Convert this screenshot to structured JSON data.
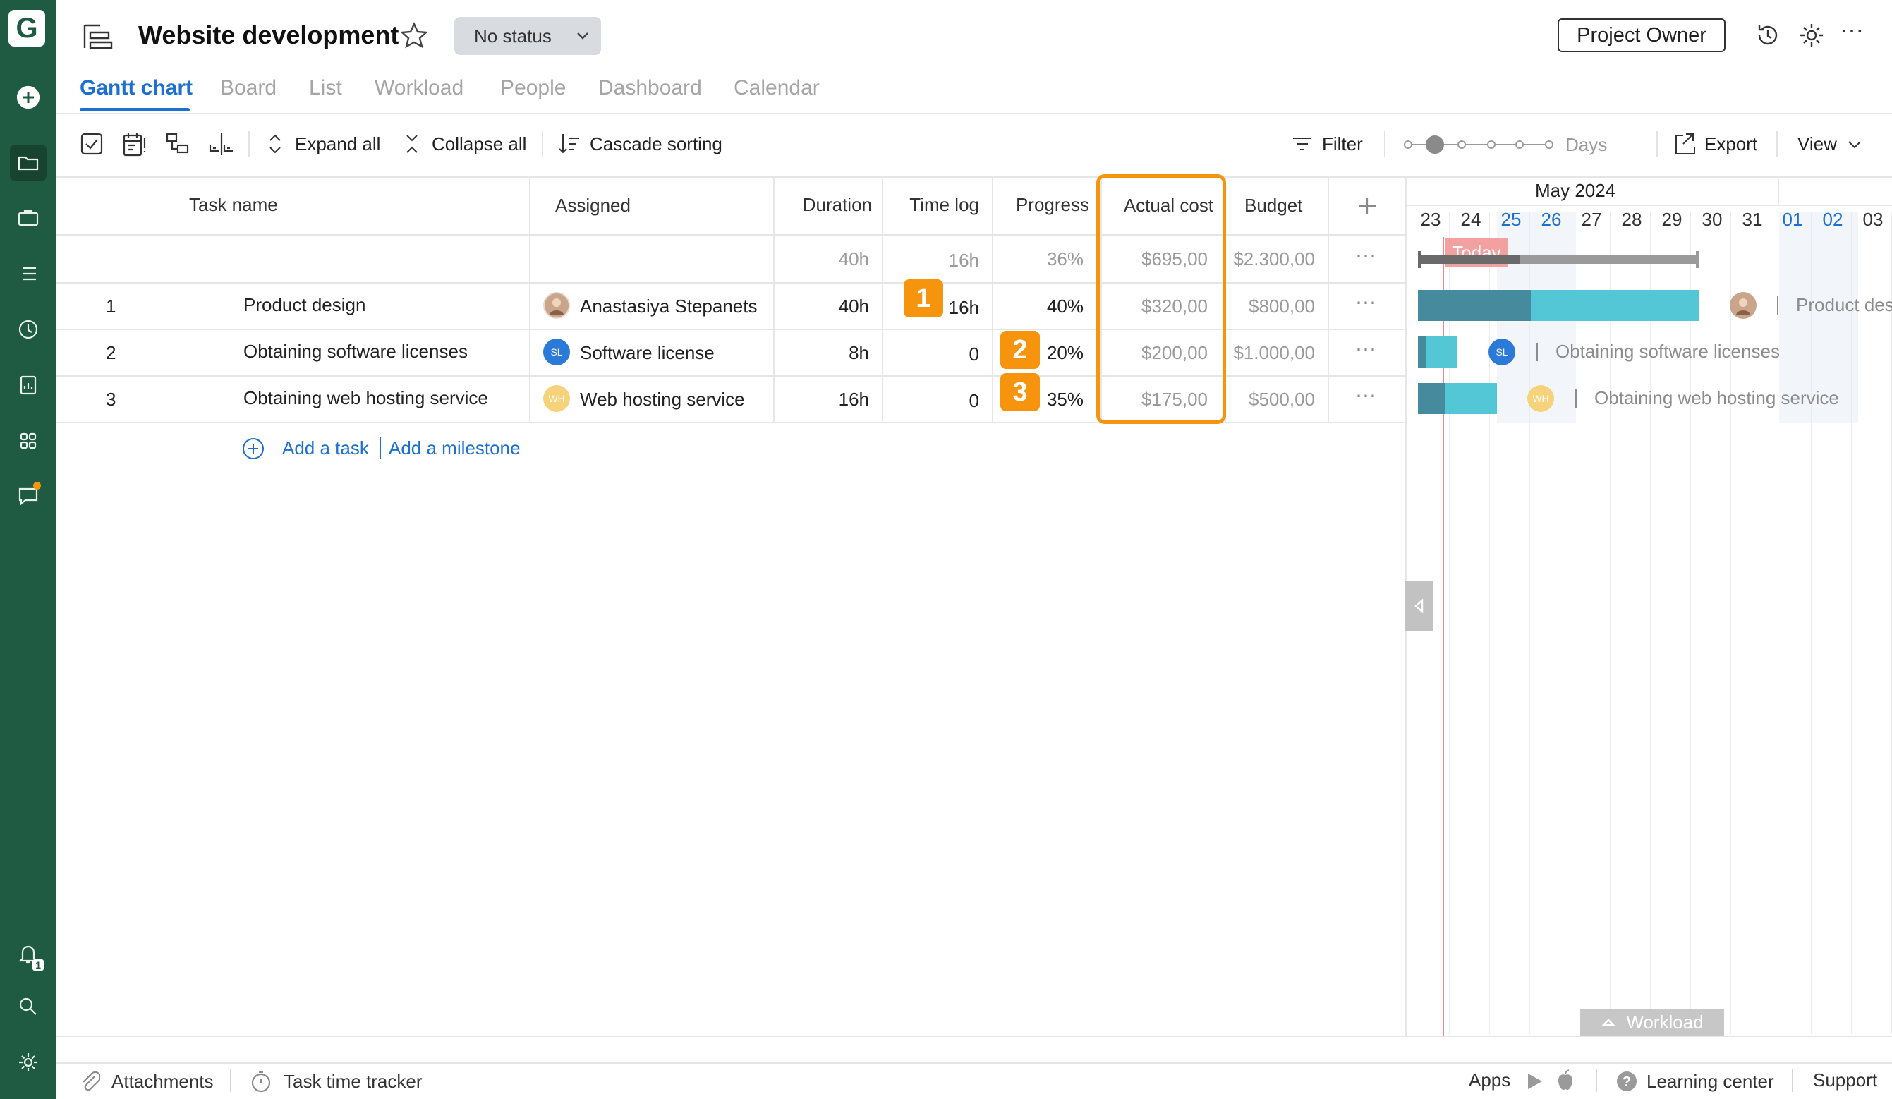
{
  "app": {
    "logo_letter": "G"
  },
  "header": {
    "title": "Website development",
    "status": "No status",
    "role_button": "Project Owner"
  },
  "tabs": [
    {
      "label": "Gantt chart"
    },
    {
      "label": "Board"
    },
    {
      "label": "List"
    },
    {
      "label": "Workload"
    },
    {
      "label": "People"
    },
    {
      "label": "Dashboard"
    },
    {
      "label": "Calendar"
    }
  ],
  "toolbar": {
    "expand_all": "Expand all",
    "collapse_all": "Collapse all",
    "cascade_sorting": "Cascade sorting",
    "filter": "Filter",
    "zoom_unit": "Days",
    "export": "Export",
    "view": "View"
  },
  "columns": {
    "task_name": "Task name",
    "assigned": "Assigned",
    "duration": "Duration",
    "time_log": "Time log",
    "progress": "Progress",
    "actual_cost": "Actual cost",
    "budget": "Budget"
  },
  "summary": {
    "duration": "40h",
    "time_log": "16h",
    "progress": "36%",
    "actual_cost": "$695,00",
    "budget": "$2.300,00"
  },
  "tasks": [
    {
      "num": "1",
      "name": "Product design",
      "assignee": "Anastasiya Stepanets",
      "initials": "",
      "duration": "40h",
      "time_log": "16h",
      "progress": "40%",
      "actual_cost": "$320,00",
      "budget": "$800,00",
      "gantt_label": "Product des"
    },
    {
      "num": "2",
      "name": "Obtaining software licenses",
      "assignee": "Software license",
      "initials": "SL",
      "duration": "8h",
      "time_log": "0",
      "progress": "20%",
      "actual_cost": "$200,00",
      "budget": "$1.000,00",
      "gantt_label": "Obtaining software licenses"
    },
    {
      "num": "3",
      "name": "Obtaining web hosting service",
      "assignee": "Web hosting service",
      "initials": "WH",
      "duration": "16h",
      "time_log": "0",
      "progress": "35%",
      "actual_cost": "$175,00",
      "budget": "$500,00",
      "gantt_label": "Obtaining web hosting service"
    }
  ],
  "add_task": "Add a task",
  "add_milestone": "Add a milestone",
  "callouts": [
    "1",
    "2",
    "3"
  ],
  "gantt": {
    "month": "May 2024",
    "days": [
      "23",
      "24",
      "25",
      "26",
      "27",
      "28",
      "29",
      "30",
      "31",
      "01",
      "02",
      "03"
    ],
    "today": "Today",
    "workload": "Workload"
  },
  "footer": {
    "attachments": "Attachments",
    "time_tracker": "Task time tracker",
    "apps": "Apps",
    "learning_center": "Learning center",
    "support": "Support"
  },
  "notifications_count": "1",
  "colors": {
    "accent": "#1d6fd0",
    "highlight": "#f7940e",
    "rail": "#1f5a43",
    "bar_dark": "#468a9d",
    "bar_light": "#54c7d7",
    "today": "#f08a8a"
  }
}
